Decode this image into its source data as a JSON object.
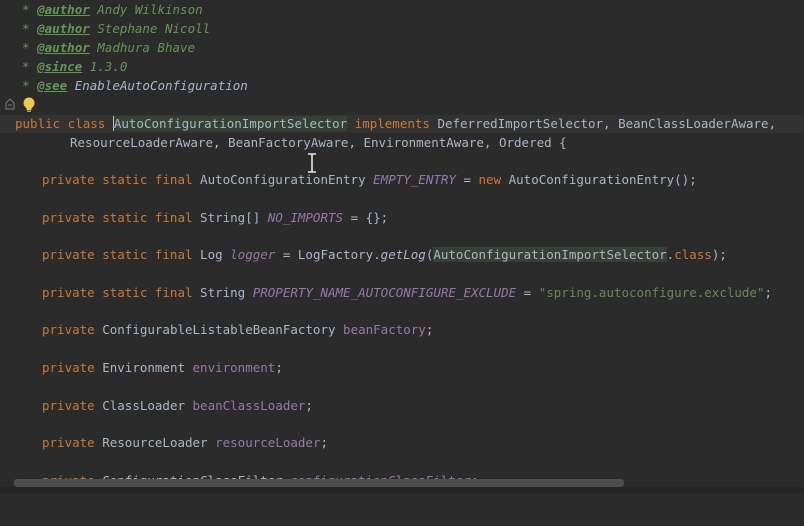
{
  "doc_lines": [
    {
      "tag": "@author",
      "text": " Andy Wilkinson"
    },
    {
      "tag": "@author",
      "text": " Stephane Nicoll"
    },
    {
      "tag": "@author",
      "text": " Madhura Bhave"
    },
    {
      "tag": "@since",
      "text": " 1.3.0"
    },
    {
      "tag": "@see",
      "ref": "EnableAutoConfiguration"
    }
  ],
  "class_decl": {
    "line1": {
      "kw": "public class ",
      "name": "AutoConfigurationImportSelector",
      "implements": " implements ",
      "interfaces": "DeferredImportSelector, BeanClassLoaderAware,"
    },
    "line2": "ResourceLoaderAware, BeanFactoryAware, EnvironmentAware, Ordered {"
  },
  "fields": [
    {
      "mods": "private static final ",
      "type": "AutoConfigurationEntry ",
      "name": "EMPTY_ENTRY",
      "const": true,
      "rest_a": " = ",
      "new_kw": "new",
      "rest_b": " AutoConfigurationEntry();"
    },
    {
      "mods": "private static final ",
      "type": "String[] ",
      "name": "NO_IMPORTS",
      "const": true,
      "rest_a": " = {};"
    },
    {
      "mods": "private static final ",
      "type": "Log ",
      "name": "logger",
      "const": true,
      "rest_a": " = LogFactory.",
      "call": "getLog",
      "rest_b": "(",
      "ref": "AutoConfigurationImportSelector",
      "rest_c": ".",
      "class_kw": "class",
      "rest_d": ");"
    },
    {
      "mods": "private static final ",
      "type": "String ",
      "name": "PROPERTY_NAME_AUTOCONFIGURE_EXCLUDE",
      "const": true,
      "rest_a": " = ",
      "str": "\"spring.autoconfigure.exclude\"",
      "rest_b": ";"
    },
    {
      "mods": "private ",
      "type": "ConfigurableListableBeanFactory ",
      "name": "beanFactory",
      "rest_a": ";"
    },
    {
      "mods": "private ",
      "type": "Environment ",
      "name": "environment",
      "rest_a": ";"
    },
    {
      "mods": "private ",
      "type": "ClassLoader ",
      "name": "beanClassLoader",
      "rest_a": ";"
    },
    {
      "mods": "private ",
      "type": "ResourceLoader ",
      "name": "resourceLoader",
      "rest_a": ";"
    },
    {
      "mods": "private ",
      "type": "ConfigurationClassFilter ",
      "name": "configurationClassFilter",
      "rest_a": ";"
    }
  ],
  "colors": {
    "background": "#2b2b2b",
    "keyword": "#cc7832",
    "field": "#9876aa",
    "string": "#6a8759",
    "doc": "#629755",
    "text": "#a9b7c6"
  }
}
